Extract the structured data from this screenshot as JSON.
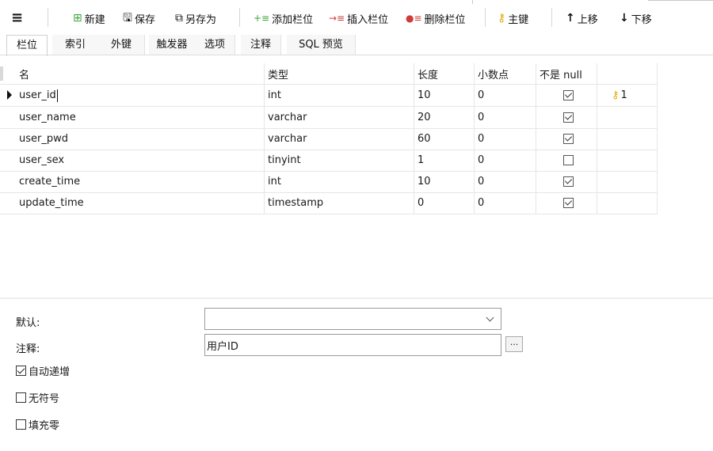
{
  "toolbar": {
    "menu_icon": "hamburger-icon",
    "new_label": "新建",
    "save_label": "保存",
    "save_as_label": "另存为",
    "add_field_label": "添加栏位",
    "insert_field_label": "插入栏位",
    "delete_field_label": "删除栏位",
    "primary_key_label": "主键",
    "move_up_label": "上移",
    "move_down_label": "下移"
  },
  "tabs": [
    "栏位",
    "索引",
    "外键",
    "触发器",
    "选项",
    "注释",
    "SQL 预览"
  ],
  "active_tab": "栏位",
  "grid": {
    "headers": [
      "名",
      "类型",
      "长度",
      "小数点",
      "不是 null",
      ""
    ],
    "rows": [
      {
        "name": "user_id",
        "type": "int",
        "length": "10",
        "decimals": "0",
        "not_null": true,
        "key": "1"
      },
      {
        "name": "user_name",
        "type": "varchar",
        "length": "20",
        "decimals": "0",
        "not_null": true,
        "key": ""
      },
      {
        "name": "user_pwd",
        "type": "varchar",
        "length": "60",
        "decimals": "0",
        "not_null": true,
        "key": ""
      },
      {
        "name": "user_sex",
        "type": "tinyint",
        "length": "1",
        "decimals": "0",
        "not_null": false,
        "key": ""
      },
      {
        "name": "create_time",
        "type": "int",
        "length": "10",
        "decimals": "0",
        "not_null": true,
        "key": ""
      },
      {
        "name": "update_time",
        "type": "timestamp",
        "length": "0",
        "decimals": "0",
        "not_null": true,
        "key": ""
      }
    ],
    "selected_row": 0
  },
  "props": {
    "default_label": "默认:",
    "default_value": "",
    "comment_label": "注释:",
    "comment_value": "用户ID",
    "browse_button": "...",
    "auto_increment_label": "自动递增",
    "auto_increment": true,
    "unsigned_label": "无符号",
    "unsigned": false,
    "zerofill_label": "填充零",
    "zerofill": false
  },
  "colors": {
    "key_icon": "#e0a800",
    "add_icon": "#3aa63a",
    "delete_icon": "#d23a3a"
  }
}
